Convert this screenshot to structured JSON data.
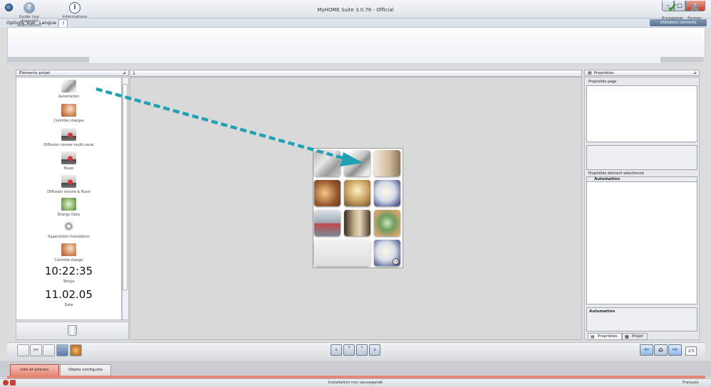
{
  "window": {
    "title": "MyHOME Suite 3.0.76 - Official",
    "user_tag": "Utilisateur connecté"
  },
  "menu": {
    "items": [
      "Options",
      "Vue",
      "Langue",
      "?"
    ]
  },
  "ribbon": {
    "guide_label": "Guide (sur dispositif sélectionné)",
    "info_label": "Informations",
    "save_label": "Enregistrer",
    "close_label": "Fermer"
  },
  "left_panel": {
    "title": "Éléments projet",
    "items": [
      {
        "label": "Automation",
        "icon": "automation-icon"
      },
      {
        "label": "Contrôle charges",
        "icon": "energy-management-icon"
      },
      {
        "label": "Diffusion sonore multi-canal",
        "icon": "sound-system-icon"
      },
      {
        "label": "Nuvo",
        "icon": "nuvo-icon"
      },
      {
        "label": "Diffusion sonore & Nuvo",
        "icon": "sound-nuvo-icon"
      },
      {
        "label": "Energy Data",
        "icon": "energy-data-icon"
      },
      {
        "label": "Supervision Installation",
        "icon": "supervision-icon"
      },
      {
        "label": "Contrôle charge",
        "icon": "load-control-icon"
      }
    ],
    "time_value": "10:22:35",
    "time_label": "Temps",
    "date_value": "11.02.05",
    "date_label": "Date"
  },
  "canvas": {
    "tab_label": "1"
  },
  "right_panel": {
    "title": "Propriétés",
    "page_props_label": "Propriétés page",
    "selected_props_label": "Propriétés élément sélectionné",
    "selected_element": "Automation",
    "description_title": "Automation",
    "tab_props": "Propriétés",
    "tab_project": "Projet"
  },
  "toolbar": {
    "page_indicator": "2/3"
  },
  "info_tabs": {
    "info": "Info et erreurs",
    "configured": "Objets configurés"
  },
  "status": {
    "text": "Installation non sauvegardé",
    "language": "Français"
  },
  "colors": {
    "arrow": "#1fa2b4",
    "close_button": "#c0402a",
    "info_tab": "#e58775"
  }
}
